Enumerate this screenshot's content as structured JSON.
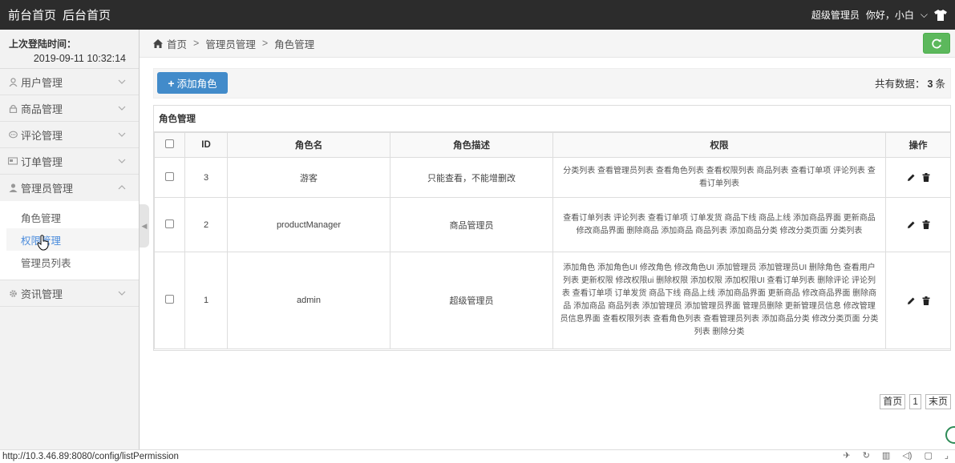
{
  "navbar": {
    "front_home": "前台首页",
    "back_home": "后台首页",
    "role": "超级管理员",
    "greeting": "你好，小白",
    "caret": "⌵",
    "shirt_icon": "tshirt-icon"
  },
  "sidebar": {
    "last_login_label": "上次登陆时间：",
    "last_login_time": "2019-09-11 10:32:14",
    "items": [
      {
        "label": "用户管理",
        "icon": "user-icon"
      },
      {
        "label": "商品管理",
        "icon": "lock-icon"
      },
      {
        "label": "评论管理",
        "icon": "comment-icon"
      },
      {
        "label": "订单管理",
        "icon": "card-icon"
      },
      {
        "label": "管理员管理",
        "icon": "user-admin-icon"
      },
      {
        "label": "资讯管理",
        "icon": "gear-icon"
      }
    ],
    "sub_items": [
      {
        "label": "角色管理"
      },
      {
        "label": "权限管理"
      },
      {
        "label": "管理员列表"
      }
    ]
  },
  "breadcrumb": {
    "home": "首页",
    "sep": ">",
    "level1": "管理员管理",
    "level2": "角色管理"
  },
  "toolbar": {
    "add_label": "添加角色",
    "plus": "+",
    "total_prefix": "共有数据：",
    "total_count": "3",
    "total_suffix": "条"
  },
  "panel": {
    "title": "角色管理",
    "headers": {
      "id": "ID",
      "name": "角色名",
      "desc": "角色描述",
      "perm": "权限",
      "ops": "操作"
    },
    "rows": [
      {
        "id": "3",
        "name": "游客",
        "desc": "只能查看，不能增删改",
        "perm": "分类列表 查看管理员列表 查看角色列表 查看权限列表 商品列表 查看订单项 评论列表 查看订单列表"
      },
      {
        "id": "2",
        "name": "productManager",
        "desc": "商品管理员",
        "perm": "查看订单列表 评论列表 查看订单项 订单发货 商品下线 商品上线 添加商品界面 更新商品 修改商品界面 删除商品 添加商品 商品列表 添加商品分类 修改分类页面 分类列表"
      },
      {
        "id": "1",
        "name": "admin",
        "desc": "超级管理员",
        "perm": "添加角色 添加角色UI 修改角色 修改角色UI 添加管理员 添加管理员UI 删除角色 查看用户列表 更新权限 修改权限ui 删除权限 添加权限 添加权限UI 查看订单列表 删除评论 评论列表 查看订单项 订单发货 商品下线 商品上线 添加商品界面 更新商品 修改商品界面 删除商品 添加商品 商品列表 添加管理员 添加管理员界面 管理员删除 更新管理员信息 修改管理员信息界面 查看权限列表 查看角色列表 查看管理员列表 添加商品分类 修改分类页面 分类列表 删除分类"
      }
    ]
  },
  "pager": {
    "first": "首页",
    "page": "1",
    "last": "末页"
  },
  "statusbar": {
    "url": "http://10.3.46.89:8080/config/listPermission"
  },
  "colors": {
    "navbar_bg": "#2c2c2c",
    "primary": "#428bca",
    "success": "#5cb85c",
    "active_link": "#4b8cdc"
  }
}
